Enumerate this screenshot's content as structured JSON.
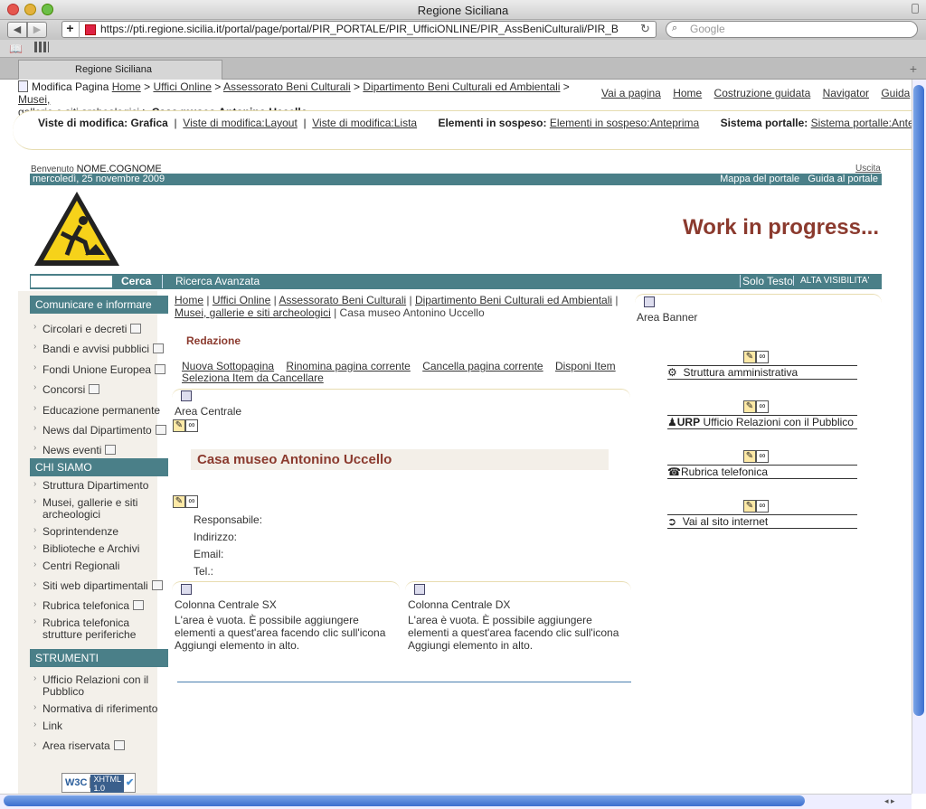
{
  "window": {
    "title": "Regione Siciliana"
  },
  "browser": {
    "url": "https://pti.regione.sicilia.it/portal/page/portal/PIR_PORTALE/PIR_UfficiONLINE/PIR_AssBeniCulturali/PIR_B",
    "search_placeholder": "Google",
    "tab_label": "Regione Siciliana",
    "back": "◀",
    "forward": "▶",
    "new_tab": "+",
    "reload": "↻"
  },
  "topnav": {
    "modify_page": "Modifica Pagina",
    "crumbs": [
      "Home",
      "Uffici Online",
      "Assessorato Beni Culturali",
      "Dipartimento Beni Culturali ed Ambientali",
      "Musei, gallerie e siti archeologici"
    ],
    "crumbs_line1_end": "Musei,",
    "crumbs_line2_start": "gallerie e siti archeologici",
    "current": "Casa museo Antonino Uccello",
    "sep": " > ",
    "links": [
      "Vai a pagina",
      "Home",
      "Costruzione guidata",
      "Navigator",
      "Guida"
    ]
  },
  "editbar": {
    "viste_label": "Viste di modifica: Grafica",
    "layout": "Viste di modifica:Layout",
    "lista": "Viste di modifica:Lista",
    "sospeso_label": "Elementi in sospeso:",
    "sospeso_link": "Elementi in sospeso:Anteprima",
    "sistema_label": "Sistema portalle:",
    "sistema_link": "Sistema portalle:AnteprimaVisu"
  },
  "header": {
    "welcome_prefix": "Benvenuto",
    "user": "NOME.COGNOME",
    "logout": "Uscita",
    "date": "mercoledì, 25 novembre 2009",
    "map": "Mappa del portale",
    "guide": "Guida al portale",
    "banner": "Work in progress..."
  },
  "searchbar": {
    "button": "Cerca",
    "advanced": "Ricerca Avanzata",
    "text_only": "Solo Testo",
    "high_vis": "ALTA VISIBILITA'"
  },
  "sidebar": {
    "sections": [
      {
        "title": "Comunicare e informare",
        "items": [
          "Circolari e decreti",
          "Bandi e avvisi pubblici",
          "Fondi Unione Europea",
          "Concorsi",
          "Educazione permanente",
          "News dal Dipartimento",
          "News eventi"
        ]
      },
      {
        "title": "CHI SIAMO",
        "items": [
          "Struttura Dipartimento",
          "Musei, gallerie e siti archeologici",
          "Soprintendenze",
          "Biblioteche e Archivi",
          "Centri Regionali",
          "Siti web dipartimentali",
          "Rubrica telefonica",
          "Rubrica telefonica strutture periferiche"
        ]
      },
      {
        "title": "STRUMENTI",
        "items": [
          "Ufficio Relazioni con il Pubblico",
          "Normativa di riferimento",
          "Link",
          "Area riservata"
        ]
      }
    ],
    "w3c": "W3C",
    "xhtml": "XHTML",
    "xhtml_ver": "1.0"
  },
  "main": {
    "crumbs": [
      "Home",
      "Uffici Online",
      "Assessorato Beni Culturali",
      "Dipartimento Beni Culturali ed Ambientali"
    ],
    "crumbs_line2_link": "Musei, gallerie e siti archeologici",
    "crumbs_current": "Casa museo Antonino Uccello",
    "redazione": "Redazione",
    "actions": [
      "Nuova Sottopagina",
      "Rinomina pagina corrente",
      "Cancella pagina corrente",
      "Disponi Item",
      "Seleziona Item da Cancellare"
    ],
    "area_centrale": "Area Centrale",
    "title": "Casa museo Antonino Uccello",
    "fields": [
      "Responsabile:",
      "Indirizzo:",
      "Email:",
      "Tel.:"
    ],
    "col_sx": "Colonna Centrale SX",
    "col_dx": "Colonna Centrale DX",
    "empty_msg": "L'area è vuota. È possibile aggiungere elementi a quest'area facendo clic sull'icona Aggiungi elemento in alto."
  },
  "right": {
    "area_banner": "Area Banner",
    "links": [
      "Struttura amministrativa",
      "URP",
      "Ufficio Relazioni con il Pubblico",
      "Rubrica telefonica",
      "Vai al sito internet"
    ]
  }
}
